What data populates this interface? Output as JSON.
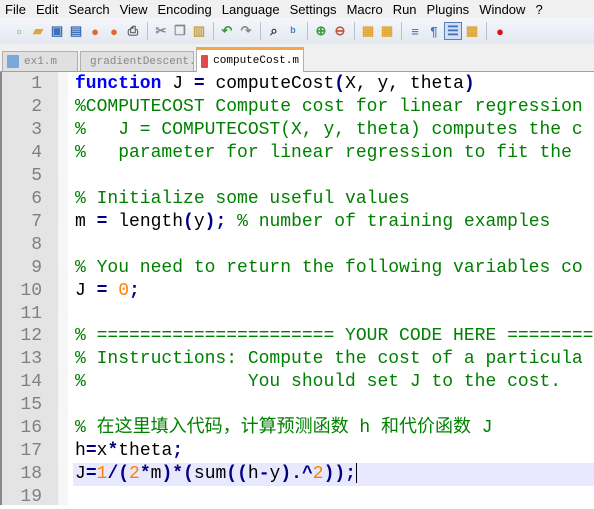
{
  "menu": [
    "File",
    "Edit",
    "Search",
    "View",
    "Encoding",
    "Language",
    "Settings",
    "Macro",
    "Run",
    "Plugins",
    "Window",
    "?"
  ],
  "toolbar": [
    {
      "icon": "new-file-icon",
      "glyph": "▫",
      "color": "#6a9a3a"
    },
    {
      "icon": "open-folder-icon",
      "glyph": "▰",
      "color": "#e0a63a"
    },
    {
      "icon": "save-icon",
      "glyph": "▣",
      "color": "#3f6fb5"
    },
    {
      "icon": "save-all-icon",
      "glyph": "▤",
      "color": "#3f6fb5"
    },
    {
      "icon": "close-file-icon",
      "glyph": "●",
      "color": "#e06a2a"
    },
    {
      "icon": "close-all-icon",
      "glyph": "●",
      "color": "#e06a2a"
    },
    {
      "icon": "print-icon",
      "glyph": "⎙",
      "color": "#555555"
    },
    {
      "sep": true
    },
    {
      "icon": "cut-icon",
      "glyph": "✂",
      "color": "#888888"
    },
    {
      "icon": "copy-icon",
      "glyph": "❐",
      "color": "#888888"
    },
    {
      "icon": "paste-icon",
      "glyph": "▥",
      "color": "#c9a04a"
    },
    {
      "sep": true
    },
    {
      "icon": "undo-icon",
      "glyph": "↶",
      "color": "#3a9a3a"
    },
    {
      "icon": "redo-icon",
      "glyph": "↷",
      "color": "#888888"
    },
    {
      "sep": true
    },
    {
      "icon": "find-icon",
      "glyph": "⌕",
      "color": "#333333"
    },
    {
      "icon": "replace-icon",
      "glyph": "ᵇ",
      "color": "#3f7fc5"
    },
    {
      "sep": true
    },
    {
      "icon": "zoom-in-icon",
      "glyph": "⊕",
      "color": "#3a9a3a"
    },
    {
      "icon": "zoom-out-icon",
      "glyph": "⊖",
      "color": "#c0503a"
    },
    {
      "sep": true
    },
    {
      "icon": "sync-vertical-icon",
      "glyph": "▦",
      "color": "#e0a63a"
    },
    {
      "icon": "sync-horizontal-icon",
      "glyph": "▦",
      "color": "#e0a63a"
    },
    {
      "sep": true
    },
    {
      "icon": "word-wrap-icon",
      "glyph": "≡",
      "color": "#3f6fb5"
    },
    {
      "icon": "show-all-chars-icon",
      "glyph": "¶",
      "color": "#3f7fc5"
    },
    {
      "icon": "indent-guide-icon",
      "glyph": "☰",
      "color": "#3f6fb5",
      "active": true
    },
    {
      "icon": "user-language-icon",
      "glyph": "▩",
      "color": "#e0a63a"
    },
    {
      "sep": true
    },
    {
      "icon": "record-macro-icon",
      "glyph": "●",
      "color": "#dd1111"
    }
  ],
  "tabs": [
    {
      "label": "ex1.m",
      "color": "#4a8fd8",
      "active": false
    },
    {
      "label": "gradientDescent.m",
      "color": "#8a7ac8",
      "active": false
    },
    {
      "label": "computeCost.m",
      "color": "#e04a4a",
      "active": true
    }
  ],
  "editor": {
    "current_line": 18,
    "lines": [
      [
        [
          "function",
          "kw"
        ],
        [
          " J ",
          "tx"
        ],
        [
          "=",
          "op"
        ],
        [
          " computeCost",
          "tx"
        ],
        [
          "(",
          "op"
        ],
        [
          "X, y, theta",
          "tx"
        ],
        [
          ")",
          "op"
        ]
      ],
      [
        [
          "%COMPUTECOST Compute cost for linear regression",
          "cm"
        ]
      ],
      [
        [
          "%   J = COMPUTECOST(X, y, theta) computes the c",
          "cm"
        ]
      ],
      [
        [
          "%   parameter for linear regression to fit the",
          "cm"
        ]
      ],
      [],
      [
        [
          "% Initialize some useful values",
          "cm"
        ]
      ],
      [
        [
          "m ",
          "tx"
        ],
        [
          "=",
          "op"
        ],
        [
          " length",
          "tx"
        ],
        [
          "(",
          "op"
        ],
        [
          "y",
          "tx"
        ],
        [
          ");",
          "op"
        ],
        [
          " ",
          "tx"
        ],
        [
          "% number of training examples",
          "cm"
        ]
      ],
      [],
      [
        [
          "% You need to return the following variables co",
          "cm"
        ]
      ],
      [
        [
          "J ",
          "tx"
        ],
        [
          "=",
          "op"
        ],
        [
          " ",
          "tx"
        ],
        [
          "0",
          "num"
        ],
        [
          ";",
          "op"
        ]
      ],
      [],
      [
        [
          "% ====================== YOUR CODE HERE ========",
          "cm"
        ]
      ],
      [
        [
          "% Instructions: Compute the cost of a particula",
          "cm"
        ]
      ],
      [
        [
          "%               You should set J to the cost.",
          "cm"
        ]
      ],
      [],
      [
        [
          "% 在这里填入代码，计算预测函数 h 和代价函数 J",
          "cm"
        ]
      ],
      [
        [
          "h",
          "tx"
        ],
        [
          "=",
          "op"
        ],
        [
          "x",
          "tx"
        ],
        [
          "*",
          "op"
        ],
        [
          "theta",
          "tx"
        ],
        [
          ";",
          "op"
        ]
      ],
      [
        [
          "J",
          "tx"
        ],
        [
          "=",
          "op"
        ],
        [
          "1",
          "num"
        ],
        [
          "/(",
          "op"
        ],
        [
          "2",
          "num"
        ],
        [
          "*",
          "op"
        ],
        [
          "m",
          "tx"
        ],
        [
          ")*(",
          "op"
        ],
        [
          "sum",
          "tx"
        ],
        [
          "((",
          "op"
        ],
        [
          "h",
          "tx"
        ],
        [
          "-",
          "op"
        ],
        [
          "y",
          "tx"
        ],
        [
          ").^",
          "op"
        ],
        [
          "2",
          "num"
        ],
        [
          "));",
          "op"
        ]
      ],
      []
    ]
  }
}
